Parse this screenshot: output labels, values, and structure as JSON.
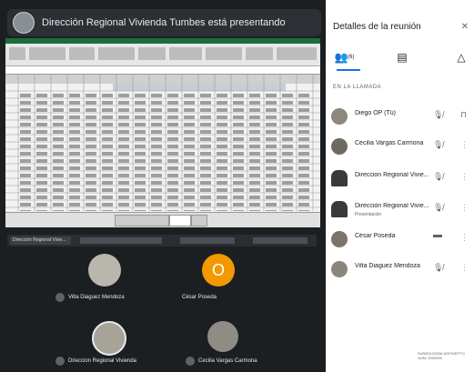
{
  "banner": {
    "text": "Dirección Regional Vivienda Tumbes está presentando"
  },
  "panel": {
    "title": "Detalles de la reunión",
    "close_icon": "close-icon",
    "tabs": [
      {
        "name": "people",
        "count": "(6)"
      },
      {
        "name": "chat"
      },
      {
        "name": "activities"
      }
    ],
    "section_label": "EN LA LLAMADA",
    "participants": [
      {
        "name": "Diego OP (Tú)",
        "sub": "",
        "mic": "mic-off",
        "extra": "pin"
      },
      {
        "name": "Cecilia Vargas Carmona",
        "sub": "",
        "mic": "mic-off",
        "extra": "more"
      },
      {
        "name": "Direccion Regional Vivie...",
        "sub": "",
        "mic": "mic-off",
        "extra": "more"
      },
      {
        "name": "Dirección Regional Vivie...",
        "sub": "Presentación",
        "mic": "mic-off",
        "extra": "more"
      },
      {
        "name": "César Poseda",
        "sub": "",
        "mic": "speaking",
        "extra": "more"
      },
      {
        "name": "Vilta Diaguez Mendoza",
        "sub": "",
        "mic": "mic-off",
        "extra": "more"
      }
    ]
  },
  "tiles": {
    "presenter_bar": "Dirección Regional Vivie...",
    "grid": [
      {
        "name": "Vilta Diaguez Mendoza"
      },
      {
        "name": "César Poseda",
        "initial": "O"
      },
      {
        "name": "Direccion Regional Vivienda"
      },
      {
        "name": "Cecilia Vargas Carmona"
      }
    ]
  },
  "watermark": "SUNEDU/ODM-ADP/DEPTO NUM: 0000000"
}
